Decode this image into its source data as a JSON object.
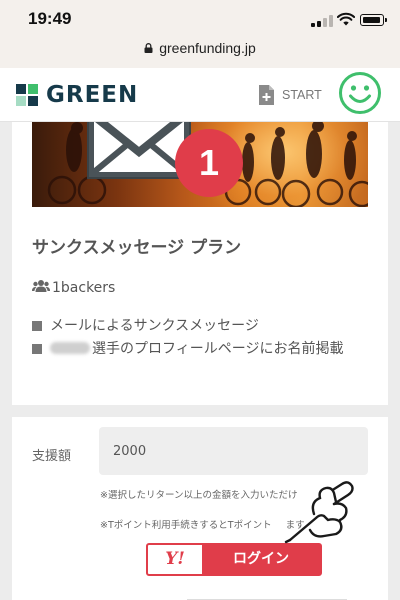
{
  "status_bar": {
    "time": "19:49",
    "signal_bars_filled": 2,
    "signal_bars_total": 4
  },
  "browser": {
    "url": "greenfunding.jp"
  },
  "header": {
    "logo_text": "GREEN",
    "start_label": "START",
    "accent_color": "#3fbf6c",
    "brand_color": "#163a4a"
  },
  "plan": {
    "badge_number": "1",
    "title": "サンクスメッセージ プラン",
    "backers": "1backers",
    "benefits": [
      "メールによるサンクスメッセージ",
      "選手のプロフィールページにお名前掲載"
    ]
  },
  "support_form": {
    "amount_label": "支援額",
    "amount_value": "2000",
    "note1": "※選択したリターン以上の金額を入力いただけ",
    "note2": "※Tポイント利用手続きするとTポイント",
    "note2_tail": "ます",
    "login_logo": "Y!",
    "login_label": "ログイン",
    "login_color": "#e03d4a"
  }
}
